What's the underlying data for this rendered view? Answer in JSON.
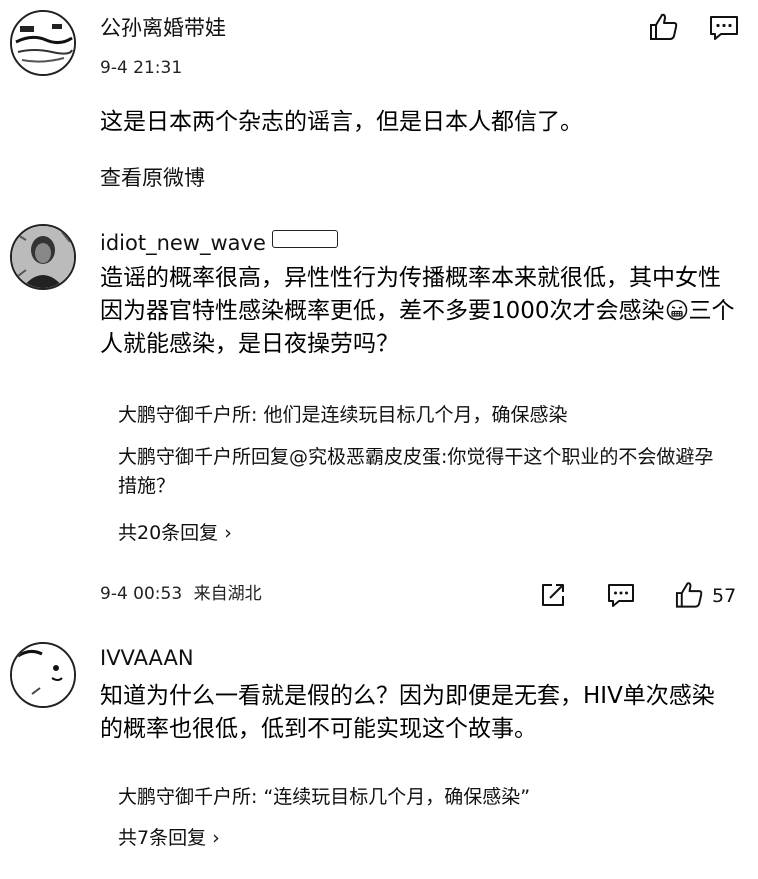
{
  "comments": [
    {
      "author": "公孙离婚带娃",
      "time": "9-4 21:31",
      "text": "这是日本两个杂志的谣言，但是日本人都信了。",
      "link": "查看原微博"
    },
    {
      "author": "idiot_new_wave",
      "badge": "",
      "text_part1": "造谣的概率很高，异性性行为传播概率本来就很低，其中女性因为器官特性感染概率更低，差不多要1000次才会感染",
      "text_part2": "三个人就能感染，是日夜操劳吗？",
      "emoji": "grimace-emoji",
      "replies": [
        "大鹏守御千户所: 他们是连续玩目标几个月，确保感染",
        "大鹏守御千户所回复@究极恶霸皮皮蛋:你觉得干这个职业的不会做避孕措施？"
      ],
      "more_replies": "共20条回复 ›",
      "time": "9-4 00:53",
      "location": "来自湖北",
      "likes": "57"
    },
    {
      "author": "IVVAAAN",
      "text": "知道为什么一看就是假的么？因为即便是无套，HIV单次感染的概率也很低，低到不可能实现这个故事。",
      "replies": [
        "大鹏守御千户所: “连续玩目标几个月，确保感染”"
      ],
      "more_replies": "共7条回复 ›"
    }
  ],
  "icons": {
    "like": "thumbs-up-icon",
    "comment": "comment-bubble-icon",
    "share": "share-icon"
  }
}
